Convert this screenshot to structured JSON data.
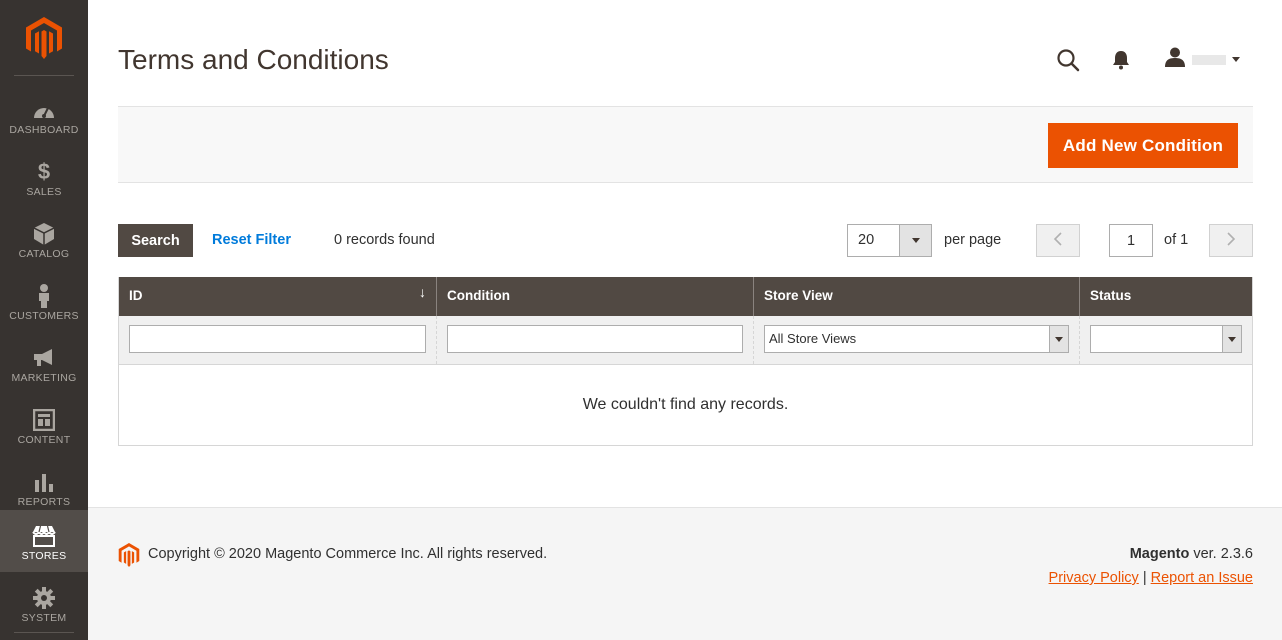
{
  "sidebar": {
    "items": [
      {
        "label": "DASHBOARD",
        "icon": "dashboard-icon"
      },
      {
        "label": "SALES",
        "icon": "dollar-icon"
      },
      {
        "label": "CATALOG",
        "icon": "box-icon"
      },
      {
        "label": "CUSTOMERS",
        "icon": "person-icon"
      },
      {
        "label": "MARKETING",
        "icon": "megaphone-icon"
      },
      {
        "label": "CONTENT",
        "icon": "layout-icon"
      },
      {
        "label": "REPORTS",
        "icon": "bar-chart-icon"
      },
      {
        "label": "STORES",
        "icon": "store-icon"
      },
      {
        "label": "SYSTEM",
        "icon": "gear-icon"
      }
    ],
    "active": "STORES"
  },
  "header": {
    "title": "Terms and Conditions"
  },
  "actions": {
    "add_label": "Add New Condition"
  },
  "toolbar": {
    "search_label": "Search",
    "reset_label": "Reset Filter",
    "records": "0 records found",
    "per_page_value": "20",
    "per_page_label": "per page",
    "page_value": "1",
    "page_of": "of 1"
  },
  "grid": {
    "columns": [
      "ID",
      "Condition",
      "Store View",
      "Status"
    ],
    "sort_indicator": "↓",
    "filters": {
      "store_view": "All Store Views",
      "status": ""
    },
    "empty_message": "We couldn't find any records."
  },
  "footer": {
    "copyright": "Copyright © 2020 Magento Commerce Inc. All rights reserved.",
    "brand": "Magento",
    "version": " ver. 2.3.6",
    "privacy": "Privacy Policy",
    "separator": " | ",
    "report": "Report an Issue"
  },
  "colors": {
    "accent": "#eb5202",
    "sidebar": "#373330",
    "grid_header": "#514943",
    "link": "#007bdb"
  }
}
